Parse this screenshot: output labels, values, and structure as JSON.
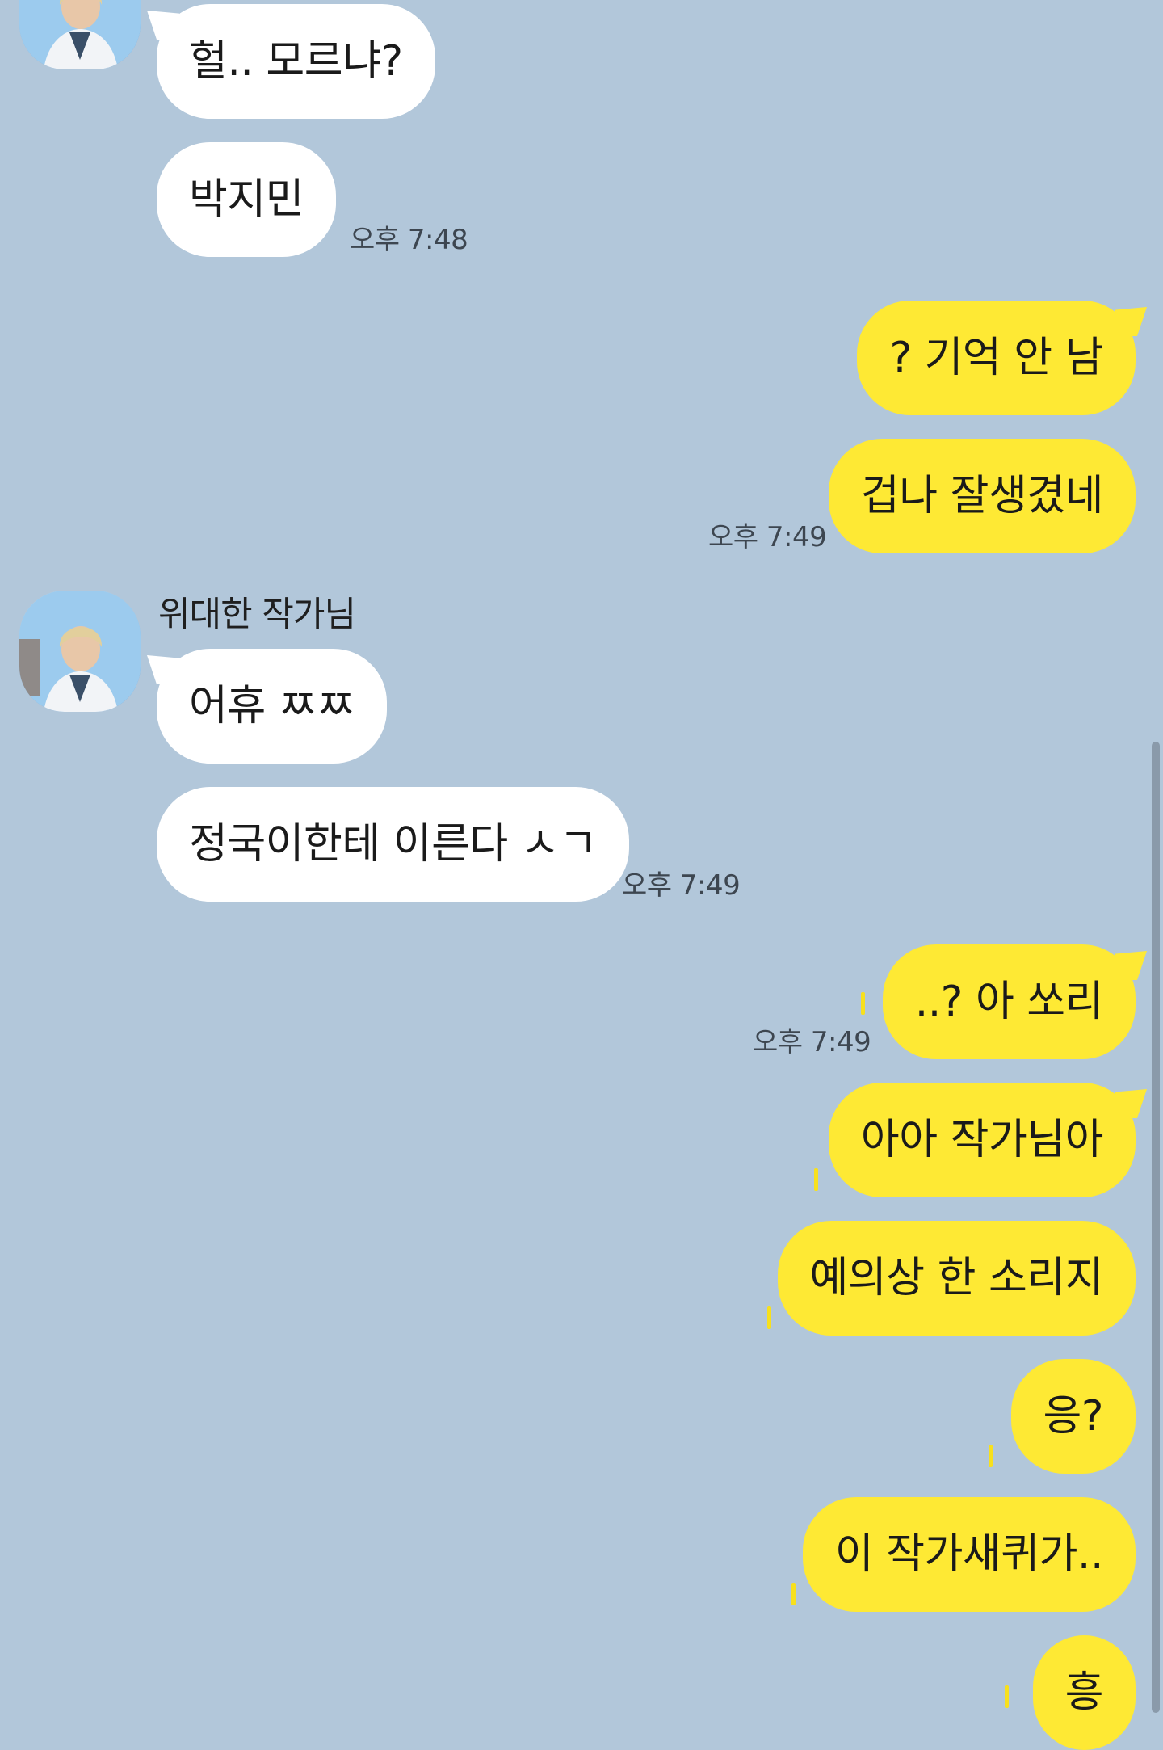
{
  "chat": {
    "sender_name": "위대한 작가님",
    "messages": [
      {
        "text": "헐.. 모르냐?"
      },
      {
        "text": "박지민",
        "time": "오후 7:48"
      },
      {
        "text": "? 기억 안 남"
      },
      {
        "text": "겁나 잘생겼네",
        "time": "오후 7:49"
      },
      {
        "text": "어휴 ㅉㅉ"
      },
      {
        "text": "정국이한테 이른다 ㅅㄱ",
        "time": "오후 7:49"
      },
      {
        "text": "..? 아 쏘리",
        "time": "오후 7:49"
      },
      {
        "text": "아아 작가님아"
      },
      {
        "text": "예의상 한 소리지"
      },
      {
        "text": "응?"
      },
      {
        "text": "이 작가새퀴가.."
      },
      {
        "text": "흥"
      }
    ]
  },
  "colors": {
    "background": "#b2c7da",
    "incoming_bubble": "#ffffff",
    "outgoing_bubble": "#fee934",
    "unread_marker": "#f7e01e"
  },
  "icons": {
    "avatar": "profile-photo-avatar"
  }
}
